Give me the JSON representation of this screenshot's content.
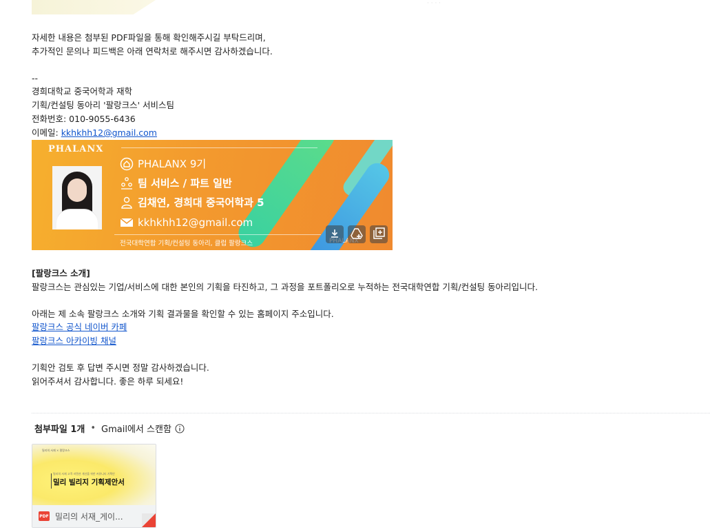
{
  "top_faint_text": "· · · ·",
  "intro": {
    "line1": "자세한 내용은 첨부된 PDF파일을 통해 확인해주시길 부탁드리며,",
    "line2": "추가적인 문의나 피드백은 아래 연락처로 해주시면 감사하겠습니다."
  },
  "signature": {
    "separator": "--",
    "school": "경희대학교 중국어학과 재학",
    "club": "기획/컨설팅 동아리 '팔랑크스' 서비스팀",
    "phone": "전화번호: 010-9055-6436",
    "email_label": "이메일: ",
    "email_link": "kkhkhh12@gmail.com"
  },
  "banner": {
    "brand": "PHALANX",
    "row1": "PHALANX 9기",
    "row2": "팀 서비스 / 파트 일반",
    "row3": "김채연, 경희대 중국어학과 5",
    "row4": "kkhkhh12@gmail.com",
    "footer": "전국대학연합 기획/컨설팅 동아리, 클럽 팔랑크스",
    "footer_brand": "PHALANX",
    "icons": [
      "home-icon",
      "team-icon",
      "person-icon",
      "mail-icon"
    ],
    "actions": [
      "download-icon",
      "save-to-drive-icon",
      "add-to-photos-icon"
    ],
    "colors": {
      "orange": "#f39a2e",
      "green": "#5ddc8a",
      "blue": "#3a8fe0"
    }
  },
  "intro_section": {
    "heading": "[팔랑크스 소개]",
    "body": "팔랑크스는 관심있는 기업/서비스에 대한 본인의 기획을 타진하고, 그 과정을 포트폴리오로 누적하는 전국대학연합 기획/컨설팅 동아리입니다.",
    "links_intro": "아래는 제 소속 팔랑크스 소개와 기획 결과물을 확인할 수 있는 홈페이지 주소입니다.",
    "link1": "팔랑크스 공식 네이버 카페",
    "link2": "팔랑크스 아카이빙 채널"
  },
  "closing": {
    "line1": "기획안 검토 후 답변 주시면 정말 감사하겠습니다.",
    "line2": "읽어주셔서 감사합니다. 좋은 하루 되세요!"
  },
  "attachments": {
    "count_label": "첨부파일 1개",
    "dot": "•",
    "scan_label": "Gmail에서 스캔함",
    "file": {
      "thumb_small": "밀리의 서재 × 팔랑크스",
      "thumb_sub": "밀리의 서재 고객 리텐션 개선을 위한 커뮤니티 기획안",
      "thumb_title": "밀리 빌리지 기획제안서",
      "type_badge": "PDF",
      "name": "밀리의 서재_게이..."
    }
  }
}
